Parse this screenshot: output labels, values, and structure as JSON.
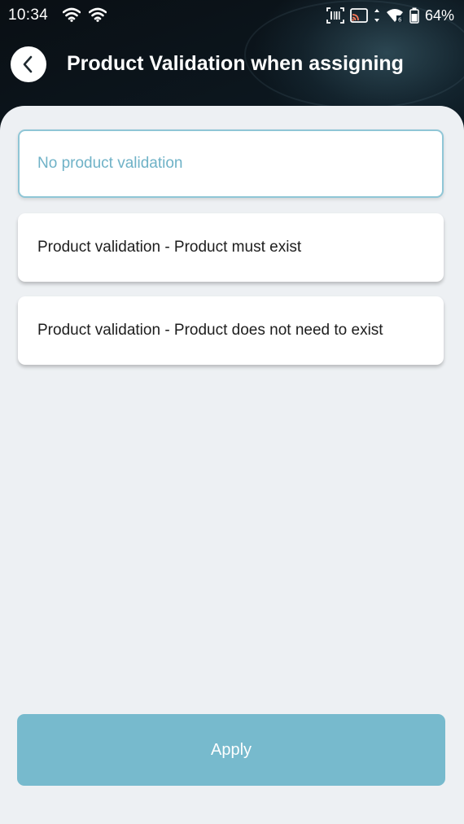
{
  "status_bar": {
    "time": "10:34",
    "battery_percent": "64%",
    "icons": [
      "wifi-icon",
      "wifi-icon",
      "barcode-scanner-icon",
      "cast-icon",
      "data-arrows-icon",
      "wifi-signal-icon",
      "battery-icon"
    ]
  },
  "header": {
    "title": "Product Validation when assigning",
    "back_icon": "chevron-left-icon"
  },
  "options": [
    {
      "label": "No product validation",
      "selected": true
    },
    {
      "label": "Product validation - Product must exist",
      "selected": false
    },
    {
      "label": "Product validation - Product does not need to exist",
      "selected": false
    }
  ],
  "apply_label": "Apply",
  "colors": {
    "accent": "#77bacd",
    "selected_text": "#6fb2c7",
    "selected_border": "#8fc6d6",
    "background": "#edf0f3"
  }
}
